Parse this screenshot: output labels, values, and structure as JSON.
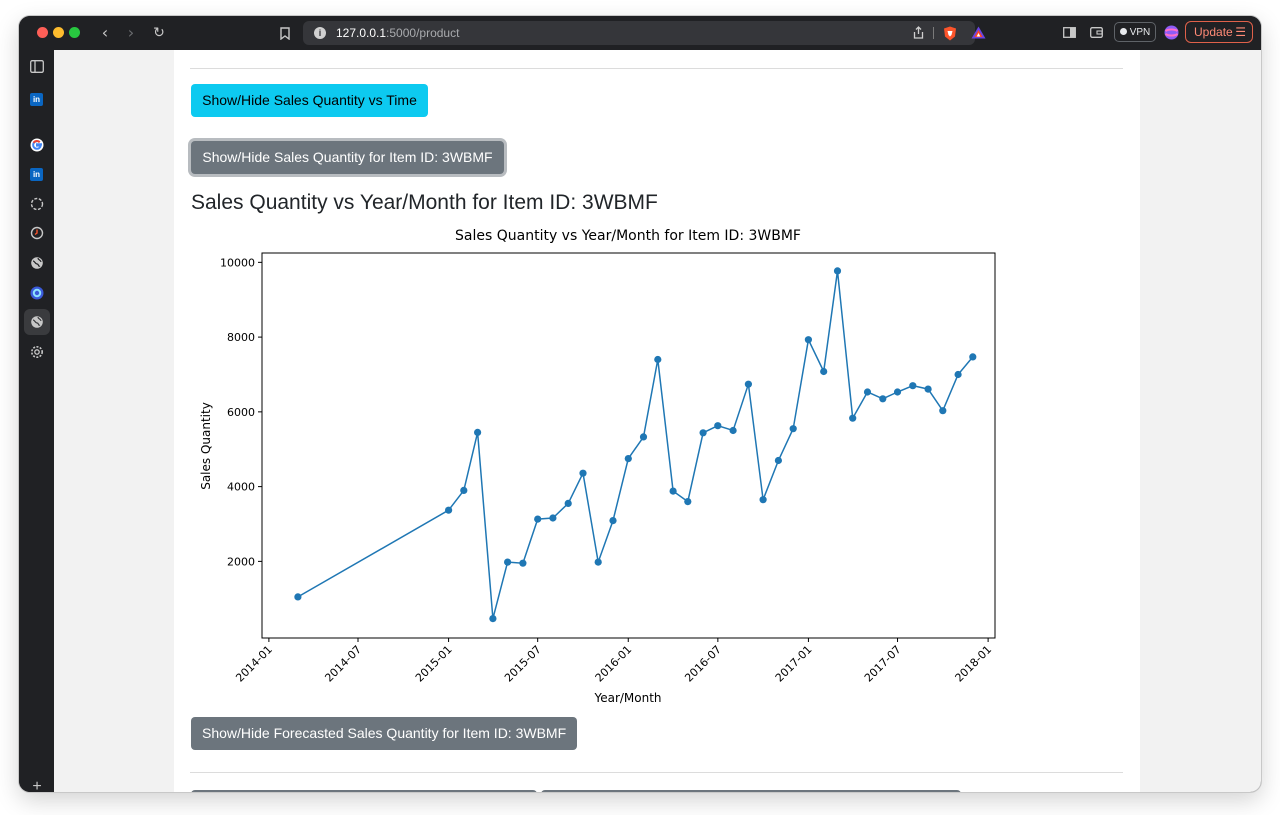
{
  "browser": {
    "url_host": "127.0.0.1",
    "url_path": ":5000/product",
    "vpn_label": "VPN",
    "update_label": "Update",
    "sidebar_icons": [
      "sidebar-toggle-icon",
      "linkedin-icon",
      "google-icon",
      "linkedin-icon",
      "circle-icon",
      "clock-icon",
      "globe-icon",
      "app-icon",
      "globe-icon",
      "gear-icon",
      "plus-icon"
    ]
  },
  "page": {
    "btn_time": "Show/Hide Sales Quantity vs Time",
    "btn_item": "Show/Hide Sales Quantity for Item ID: 3WBMF",
    "heading": "Sales Quantity vs Year/Month for Item ID: 3WBMF",
    "btn_forecast": "Show/Hide Forecasted Sales Quantity for Item ID: 3WBMF"
  },
  "chart_data": {
    "type": "line",
    "title": "Sales Quantity vs Year/Month for Item ID: 3WBMF",
    "xlabel": "Year/Month",
    "ylabel": "Sales Quantity",
    "xticks": [
      "2014-01",
      "2014-07",
      "2015-01",
      "2015-07",
      "2016-01",
      "2016-07",
      "2017-01",
      "2017-07",
      "2018-01"
    ],
    "yticks": [
      2000,
      4000,
      6000,
      8000,
      10000
    ],
    "ylim": [
      -50,
      10250
    ],
    "xlim": [
      "2013-12-18",
      "2018-01-15"
    ],
    "color": "#1f77b4",
    "grid": false,
    "x": [
      "2014-03",
      "2015-01",
      "2015-02",
      "2015-03",
      "2015-04",
      "2015-05",
      "2015-06",
      "2015-07",
      "2015-08",
      "2015-09",
      "2015-10",
      "2015-11",
      "2015-12",
      "2016-01",
      "2016-02",
      "2016-03",
      "2016-04",
      "2016-05",
      "2016-06",
      "2016-07",
      "2016-08",
      "2016-09",
      "2016-10",
      "2016-11",
      "2016-12",
      "2017-01",
      "2017-02",
      "2017-03",
      "2017-04",
      "2017-05",
      "2017-06",
      "2017-07",
      "2017-08",
      "2017-09",
      "2017-10",
      "2017-11",
      "2017-12"
    ],
    "y": [
      1050,
      3370,
      3900,
      5450,
      470,
      1980,
      1950,
      3130,
      3160,
      3550,
      4360,
      1980,
      3090,
      4750,
      5330,
      7400,
      3880,
      3600,
      5440,
      5630,
      5500,
      6740,
      3650,
      4700,
      5550,
      7930,
      7080,
      9770,
      5830,
      6530,
      6350,
      6530,
      6700,
      6610,
      6030,
      7000,
      7470
    ]
  }
}
